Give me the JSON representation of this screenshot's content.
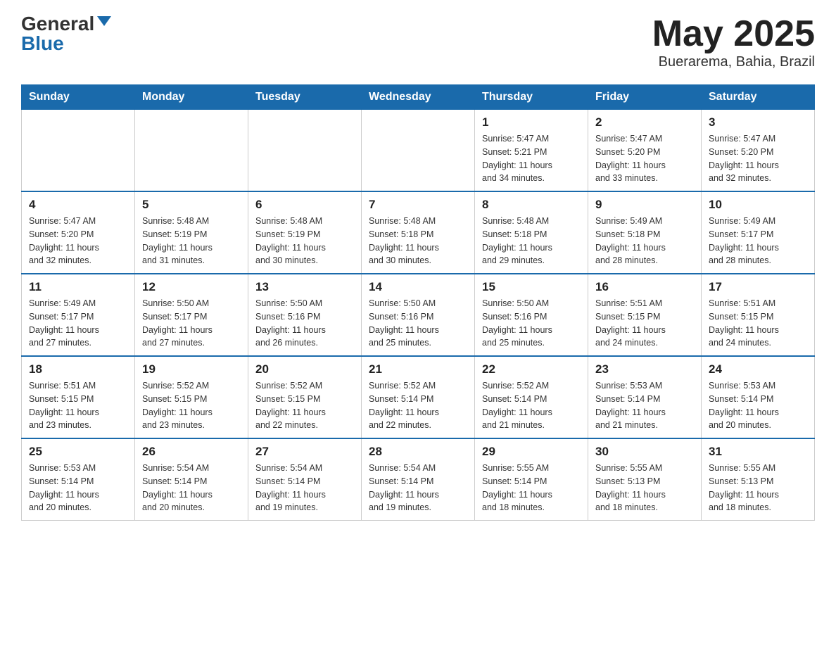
{
  "header": {
    "logo_general": "General",
    "logo_blue": "Blue",
    "title": "May 2025",
    "subtitle": "Buerarema, Bahia, Brazil"
  },
  "weekdays": [
    "Sunday",
    "Monday",
    "Tuesday",
    "Wednesday",
    "Thursday",
    "Friday",
    "Saturday"
  ],
  "weeks": [
    [
      {
        "day": "",
        "info": ""
      },
      {
        "day": "",
        "info": ""
      },
      {
        "day": "",
        "info": ""
      },
      {
        "day": "",
        "info": ""
      },
      {
        "day": "1",
        "info": "Sunrise: 5:47 AM\nSunset: 5:21 PM\nDaylight: 11 hours\nand 34 minutes."
      },
      {
        "day": "2",
        "info": "Sunrise: 5:47 AM\nSunset: 5:20 PM\nDaylight: 11 hours\nand 33 minutes."
      },
      {
        "day": "3",
        "info": "Sunrise: 5:47 AM\nSunset: 5:20 PM\nDaylight: 11 hours\nand 32 minutes."
      }
    ],
    [
      {
        "day": "4",
        "info": "Sunrise: 5:47 AM\nSunset: 5:20 PM\nDaylight: 11 hours\nand 32 minutes."
      },
      {
        "day": "5",
        "info": "Sunrise: 5:48 AM\nSunset: 5:19 PM\nDaylight: 11 hours\nand 31 minutes."
      },
      {
        "day": "6",
        "info": "Sunrise: 5:48 AM\nSunset: 5:19 PM\nDaylight: 11 hours\nand 30 minutes."
      },
      {
        "day": "7",
        "info": "Sunrise: 5:48 AM\nSunset: 5:18 PM\nDaylight: 11 hours\nand 30 minutes."
      },
      {
        "day": "8",
        "info": "Sunrise: 5:48 AM\nSunset: 5:18 PM\nDaylight: 11 hours\nand 29 minutes."
      },
      {
        "day": "9",
        "info": "Sunrise: 5:49 AM\nSunset: 5:18 PM\nDaylight: 11 hours\nand 28 minutes."
      },
      {
        "day": "10",
        "info": "Sunrise: 5:49 AM\nSunset: 5:17 PM\nDaylight: 11 hours\nand 28 minutes."
      }
    ],
    [
      {
        "day": "11",
        "info": "Sunrise: 5:49 AM\nSunset: 5:17 PM\nDaylight: 11 hours\nand 27 minutes."
      },
      {
        "day": "12",
        "info": "Sunrise: 5:50 AM\nSunset: 5:17 PM\nDaylight: 11 hours\nand 27 minutes."
      },
      {
        "day": "13",
        "info": "Sunrise: 5:50 AM\nSunset: 5:16 PM\nDaylight: 11 hours\nand 26 minutes."
      },
      {
        "day": "14",
        "info": "Sunrise: 5:50 AM\nSunset: 5:16 PM\nDaylight: 11 hours\nand 25 minutes."
      },
      {
        "day": "15",
        "info": "Sunrise: 5:50 AM\nSunset: 5:16 PM\nDaylight: 11 hours\nand 25 minutes."
      },
      {
        "day": "16",
        "info": "Sunrise: 5:51 AM\nSunset: 5:15 PM\nDaylight: 11 hours\nand 24 minutes."
      },
      {
        "day": "17",
        "info": "Sunrise: 5:51 AM\nSunset: 5:15 PM\nDaylight: 11 hours\nand 24 minutes."
      }
    ],
    [
      {
        "day": "18",
        "info": "Sunrise: 5:51 AM\nSunset: 5:15 PM\nDaylight: 11 hours\nand 23 minutes."
      },
      {
        "day": "19",
        "info": "Sunrise: 5:52 AM\nSunset: 5:15 PM\nDaylight: 11 hours\nand 23 minutes."
      },
      {
        "day": "20",
        "info": "Sunrise: 5:52 AM\nSunset: 5:15 PM\nDaylight: 11 hours\nand 22 minutes."
      },
      {
        "day": "21",
        "info": "Sunrise: 5:52 AM\nSunset: 5:14 PM\nDaylight: 11 hours\nand 22 minutes."
      },
      {
        "day": "22",
        "info": "Sunrise: 5:52 AM\nSunset: 5:14 PM\nDaylight: 11 hours\nand 21 minutes."
      },
      {
        "day": "23",
        "info": "Sunrise: 5:53 AM\nSunset: 5:14 PM\nDaylight: 11 hours\nand 21 minutes."
      },
      {
        "day": "24",
        "info": "Sunrise: 5:53 AM\nSunset: 5:14 PM\nDaylight: 11 hours\nand 20 minutes."
      }
    ],
    [
      {
        "day": "25",
        "info": "Sunrise: 5:53 AM\nSunset: 5:14 PM\nDaylight: 11 hours\nand 20 minutes."
      },
      {
        "day": "26",
        "info": "Sunrise: 5:54 AM\nSunset: 5:14 PM\nDaylight: 11 hours\nand 20 minutes."
      },
      {
        "day": "27",
        "info": "Sunrise: 5:54 AM\nSunset: 5:14 PM\nDaylight: 11 hours\nand 19 minutes."
      },
      {
        "day": "28",
        "info": "Sunrise: 5:54 AM\nSunset: 5:14 PM\nDaylight: 11 hours\nand 19 minutes."
      },
      {
        "day": "29",
        "info": "Sunrise: 5:55 AM\nSunset: 5:14 PM\nDaylight: 11 hours\nand 18 minutes."
      },
      {
        "day": "30",
        "info": "Sunrise: 5:55 AM\nSunset: 5:13 PM\nDaylight: 11 hours\nand 18 minutes."
      },
      {
        "day": "31",
        "info": "Sunrise: 5:55 AM\nSunset: 5:13 PM\nDaylight: 11 hours\nand 18 minutes."
      }
    ]
  ]
}
